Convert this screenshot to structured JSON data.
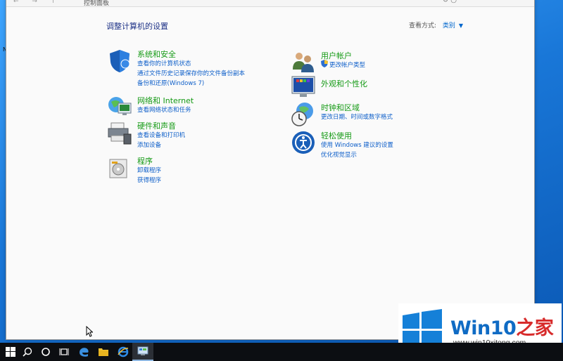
{
  "address_bar": {
    "nav_arrows": "← → ↑",
    "breadcrumb": "控制面板",
    "right_glyph": "↻ ○"
  },
  "main": {
    "heading": "调整计算机的设置",
    "view_by_label": "查看方式:",
    "view_by_value": "类别"
  },
  "categories": [
    {
      "id": "system-security",
      "icon": "shield-icon",
      "title": "系统和安全",
      "links": [
        "查看你的计算机状态",
        "通过文件历史记录保存你的文件备份副本",
        "备份和还原(Windows 7)"
      ]
    },
    {
      "id": "network",
      "icon": "network-globe-icon",
      "title": "网络和 Internet",
      "links": [
        "查看网络状态和任务"
      ]
    },
    {
      "id": "hardware-sound",
      "icon": "printer-icon",
      "title": "硬件和声音",
      "links": [
        "查看设备和打印机",
        "添加设备"
      ]
    },
    {
      "id": "programs",
      "icon": "programs-disc-icon",
      "title": "程序",
      "links": [
        "卸载程序",
        "获得程序"
      ]
    },
    {
      "id": "user-accounts",
      "icon": "users-icon",
      "title": "用户帐户",
      "links": [
        "更改帐户类型"
      ]
    },
    {
      "id": "appearance",
      "icon": "monitor-palette-icon",
      "title": "外观和个性化",
      "links": []
    },
    {
      "id": "clock-region",
      "icon": "clock-globe-icon",
      "title": "时钟和区域",
      "links": [
        "更改日期、时间或数字格式"
      ]
    },
    {
      "id": "ease-of-access",
      "icon": "ease-of-access-icon",
      "title": "轻松使用",
      "links": [
        "使用 Windows 建议的设置",
        "优化视觉显示"
      ]
    }
  ],
  "taskbar": {
    "items": [
      "start-icon",
      "search-icon",
      "cortana-icon",
      "task-view-icon",
      "edge-icon",
      "file-explorer-icon",
      "ie-icon",
      "control-panel-icon"
    ]
  },
  "watermark": {
    "title_prefix": "Win10",
    "title_suffix": "之家",
    "url": "www.win10xitong.com"
  },
  "colors": {
    "category_title": "#159a15",
    "link": "#0e5fc9",
    "heading": "#1e3287",
    "watermark_blue": "#0f6bc4",
    "watermark_red": "#d72b2b"
  }
}
